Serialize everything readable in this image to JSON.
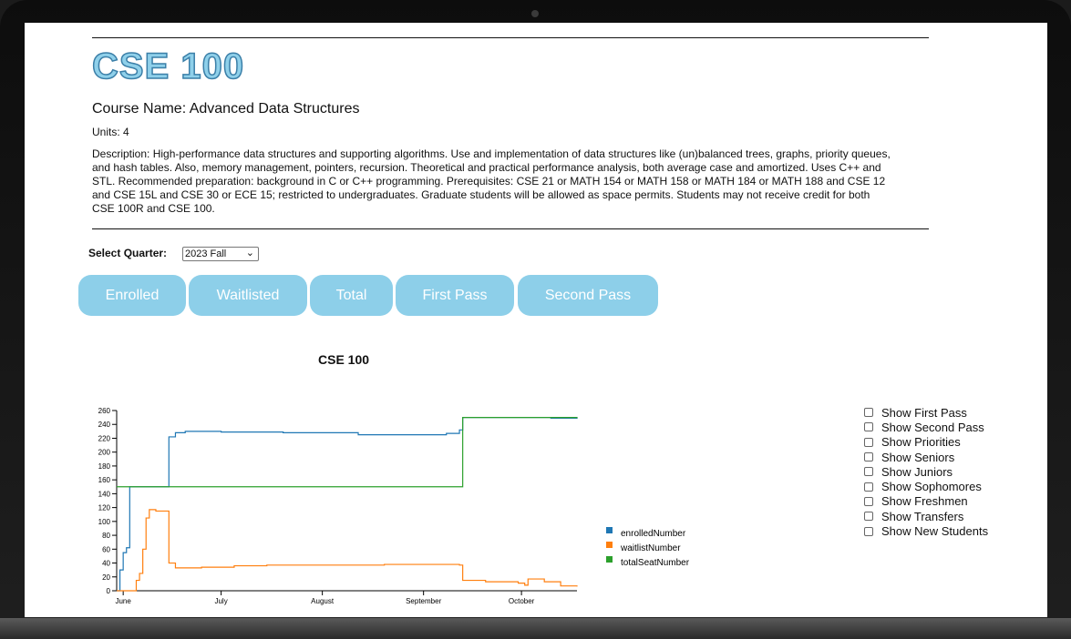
{
  "course": {
    "code": "CSE 100",
    "name": "Course Name: Advanced Data Structures",
    "units": "Units: 4",
    "description": "Description: High-performance data structures and supporting algorithms. Use and implementation of data structures like (un)balanced trees, graphs, priority queues, and hash tables. Also, memory management, pointers, recursion. Theoretical and practical performance analysis, both average case and amortized. Uses C++ and STL. Recommended preparation: background in C or C++ programming. Prerequisites: CSE 21 or MATH 154 or MATH 158 or MATH 184 or MATH 188 and CSE 12 and CSE 15L and CSE 30 or ECE 15; restricted to undergraduates. Graduate students will be allowed as space permits. Students may not receive credit for both CSE 100R and CSE 100."
  },
  "quarter": {
    "label": "Select Quarter:",
    "selected": "2023 Fall",
    "arrow_icon": "chevron-down-icon"
  },
  "buttons": [
    "Enrolled",
    "Waitlisted",
    "Total",
    "First Pass",
    "Second Pass"
  ],
  "checkboxes": [
    "Show First Pass",
    "Show Second Pass",
    "Show Priorities",
    "Show Seniors",
    "Show Juniors",
    "Show Sophomores",
    "Show Freshmen",
    "Show Transfers",
    "Show New Students"
  ],
  "colors": {
    "button_bg": "#8dcfe9",
    "title_fill": "#8fd0ea",
    "enrolled": "#1f77b4",
    "waitlist": "#ff7f0e",
    "total": "#2ca02c"
  },
  "chart_data": {
    "type": "line",
    "title": "CSE 100",
    "xlabel": "",
    "ylabel": "",
    "x_ticks": [
      "June",
      "July",
      "August",
      "September",
      "October"
    ],
    "y_ticks": [
      0,
      20,
      40,
      60,
      80,
      100,
      120,
      140,
      160,
      180,
      200,
      220,
      240,
      260
    ],
    "ylim": [
      0,
      260
    ],
    "xlim": [
      "2023-05-30",
      "2023-10-18"
    ],
    "legend": "right",
    "series": [
      {
        "name": "enrolledNumber",
        "color": "#1f77b4",
        "points": [
          [
            "2023-05-30",
            0
          ],
          [
            "2023-05-31",
            30
          ],
          [
            "2023-06-01",
            55
          ],
          [
            "2023-06-02",
            62
          ],
          [
            "2023-06-03",
            150
          ],
          [
            "2023-06-14",
            150
          ],
          [
            "2023-06-15",
            222
          ],
          [
            "2023-06-17",
            228
          ],
          [
            "2023-06-20",
            230
          ],
          [
            "2023-07-01",
            229
          ],
          [
            "2023-07-20",
            228
          ],
          [
            "2023-08-10",
            228
          ],
          [
            "2023-08-12",
            225
          ],
          [
            "2023-09-05",
            225
          ],
          [
            "2023-09-08",
            227
          ],
          [
            "2023-09-12",
            232
          ],
          [
            "2023-09-13",
            250
          ],
          [
            "2023-10-10",
            249
          ],
          [
            "2023-10-18",
            248
          ]
        ]
      },
      {
        "name": "waitlistNumber",
        "color": "#ff7f0e",
        "points": [
          [
            "2023-05-30",
            0
          ],
          [
            "2023-06-04",
            0
          ],
          [
            "2023-06-05",
            15
          ],
          [
            "2023-06-06",
            25
          ],
          [
            "2023-06-07",
            60
          ],
          [
            "2023-06-08",
            105
          ],
          [
            "2023-06-09",
            117
          ],
          [
            "2023-06-11",
            115
          ],
          [
            "2023-06-14",
            115
          ],
          [
            "2023-06-15",
            40
          ],
          [
            "2023-06-17",
            33
          ],
          [
            "2023-06-25",
            34
          ],
          [
            "2023-07-05",
            36
          ],
          [
            "2023-07-15",
            37
          ],
          [
            "2023-08-01",
            37
          ],
          [
            "2023-08-20",
            38
          ],
          [
            "2023-09-08",
            38
          ],
          [
            "2023-09-12",
            37
          ],
          [
            "2023-09-13",
            15
          ],
          [
            "2023-09-20",
            13
          ],
          [
            "2023-09-30",
            11
          ],
          [
            "2023-10-02",
            8
          ],
          [
            "2023-10-03",
            17
          ],
          [
            "2023-10-08",
            13
          ],
          [
            "2023-10-13",
            7
          ],
          [
            "2023-10-18",
            6
          ]
        ]
      },
      {
        "name": "totalSeatNumber",
        "color": "#2ca02c",
        "points": [
          [
            "2023-05-30",
            150
          ],
          [
            "2023-09-12",
            150
          ],
          [
            "2023-09-13",
            250
          ],
          [
            "2023-10-18",
            249
          ]
        ]
      }
    ]
  }
}
